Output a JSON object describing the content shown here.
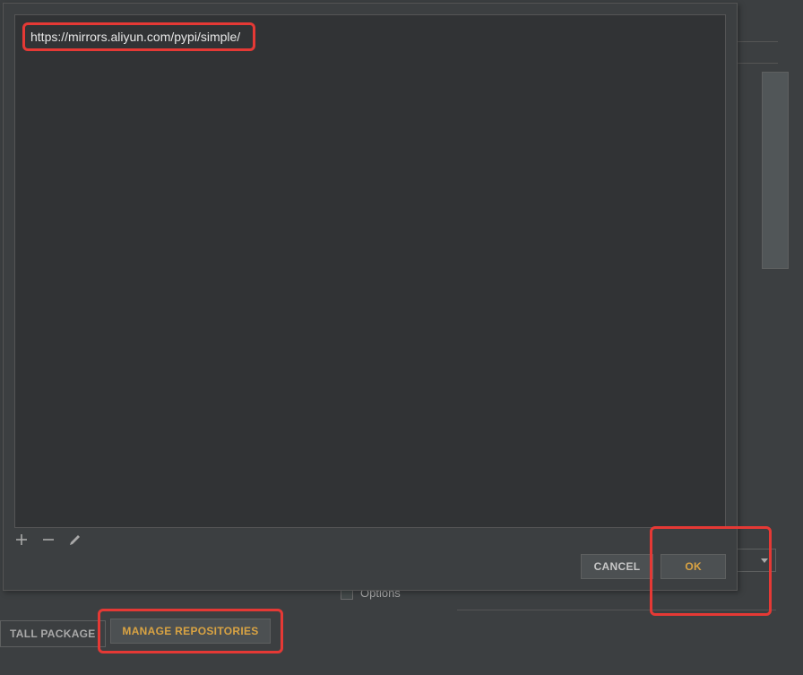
{
  "dialog": {
    "repositories": [
      "https://mirrors.aliyun.com/pypi/simple/"
    ],
    "buttons": {
      "cancel": "CANCEL",
      "ok": "OK"
    }
  },
  "background": {
    "options_label": "Options",
    "install_package_label": "TALL PACKAGE",
    "manage_repos_label": "MANAGE REPOSITORIES"
  },
  "highlight_color": "#e53935",
  "accent_color": "#d9a343"
}
